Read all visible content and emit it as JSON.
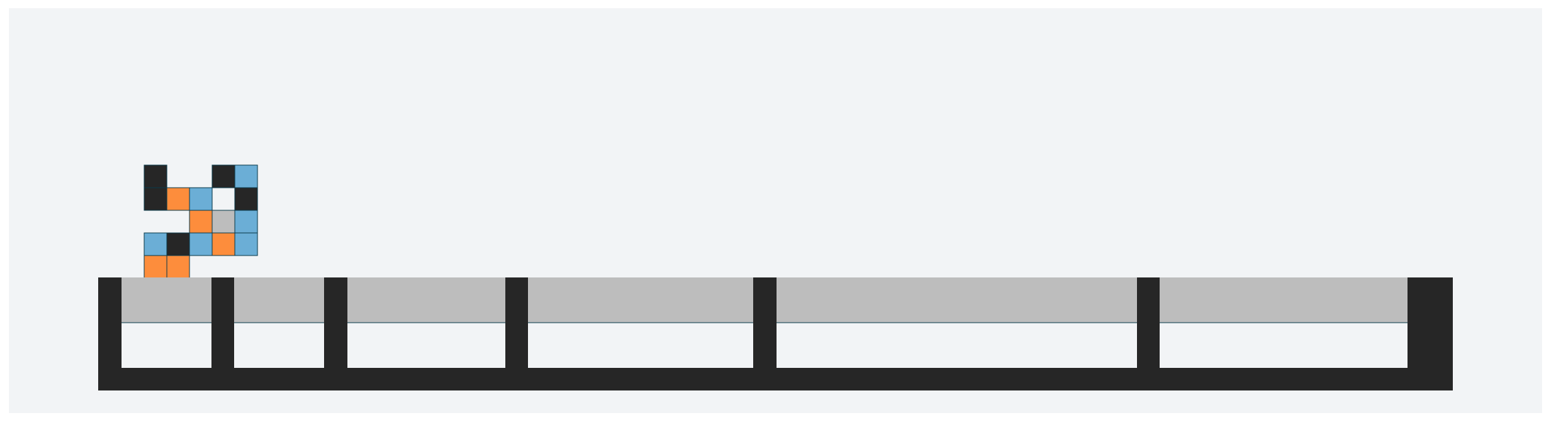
{
  "colors": {
    "page_background": "#ffffff",
    "board_background": "#f2f4f6",
    "black": "#262626",
    "blue": "#6baed6",
    "orange": "#fd8d3c",
    "gray": "#bdbdbd",
    "white": "#f2f4f6",
    "cell_outline": "#0b3a4a"
  },
  "piece": {
    "name": "falling-piece",
    "grid": [
      [
        "black",
        "empty",
        "empty",
        "black",
        "blue"
      ],
      [
        "black",
        "orange",
        "blue",
        "white",
        "black"
      ],
      [
        "empty",
        "empty",
        "orange",
        "gray",
        "blue"
      ],
      [
        "blue",
        "black",
        "blue",
        "orange",
        "blue"
      ],
      [
        "orange",
        "orange",
        "empty",
        "empty",
        "empty"
      ]
    ]
  },
  "tray": {
    "compartment_count": 6,
    "compartments": [
      {
        "name": "slot-1"
      },
      {
        "name": "slot-2"
      },
      {
        "name": "slot-3"
      },
      {
        "name": "slot-4"
      },
      {
        "name": "slot-5"
      },
      {
        "name": "slot-6"
      }
    ]
  }
}
